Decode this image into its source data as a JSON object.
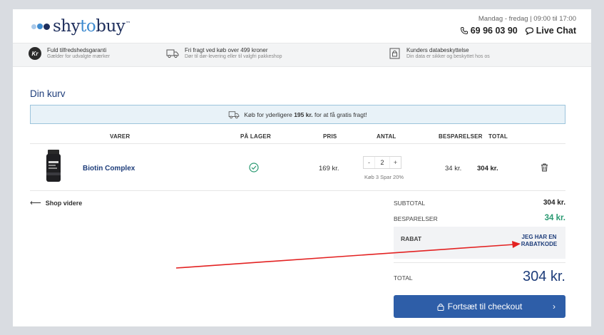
{
  "brand": {
    "logo_text_1": "shy",
    "logo_text_2": "to",
    "logo_text_3": "buy",
    "logo_tm": "™",
    "dot_colors": [
      "#a9c9ea",
      "#3e8bd0",
      "#1e2e5c"
    ]
  },
  "header": {
    "hours": "Mandag - fredag | 09:00 til 17:00",
    "phone": "69 96 03 90",
    "live_chat": "Live Chat"
  },
  "features": [
    {
      "icon": "kr-icon",
      "icon_text": "Kr",
      "title": "Fuld tilfredshedsgaranti",
      "subtitle": "Gælder for udvalgte mærker"
    },
    {
      "icon": "truck-icon",
      "title": "Fri fragt ved køb over 499 kroner",
      "subtitle": "Dør til dør-levering eller til valgfri pakkeshop"
    },
    {
      "icon": "shield-icon",
      "title": "Kunders databeskyttelse",
      "subtitle": "Din data er sikker og beskyttet hos os"
    }
  ],
  "cart": {
    "title": "Din kurv",
    "promo_prefix": "Køb for yderligere ",
    "promo_amount": "195 kr.",
    "promo_suffix": " for at få gratis fragt!",
    "columns": {
      "items": "VARER",
      "stock": "PÅ LAGER",
      "price": "PRIS",
      "qty": "ANTAL",
      "savings": "BESPARELSER",
      "total": "TOTAL"
    },
    "items": [
      {
        "name": "Biotin Complex",
        "in_stock": true,
        "price": "169 kr.",
        "qty": "2",
        "qty_minus": "-",
        "qty_plus": "+",
        "offer": "Køb 3 Spar 20%",
        "savings": "34 kr.",
        "total": "304 kr."
      }
    ]
  },
  "shop_more": {
    "arrow": "⟵",
    "label": "Shop videre"
  },
  "summary": {
    "subtotal_label": "SUBTOTAL",
    "subtotal_value": "304 kr.",
    "savings_label": "BESPARELSER",
    "savings_value": "34 kr.",
    "discount_label": "RABAT",
    "discount_link": "JEG HAR EN RABATKODE",
    "total_label": "TOTAL",
    "total_value": "304 kr.",
    "checkout_label": "Fortsæt til checkout",
    "checkout_chevron": "›"
  },
  "colors": {
    "brand_blue": "#1e3d7a",
    "button_blue": "#2e5ea8",
    "accent_green": "#2a9a72",
    "annotation_red": "#e32222"
  }
}
